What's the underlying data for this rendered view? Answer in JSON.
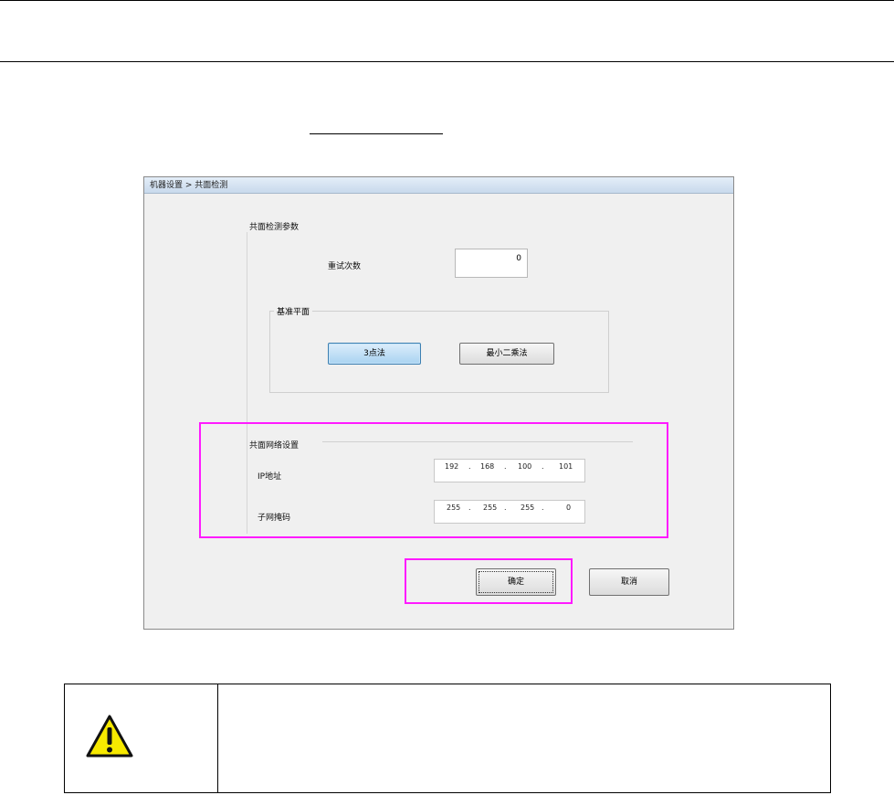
{
  "dialog": {
    "title": "机器设置 > 共面检测",
    "params_section": "共面检测参数",
    "retry_label": "重试次数",
    "retry_value": "0",
    "ref_plane_group": "基准平面",
    "btn_3point": "3点法",
    "btn_lsq": "最小二乘法",
    "network_section": "共面网络设置",
    "ip_label": "IP地址",
    "ip_octets": [
      "192",
      "168",
      "100",
      "101"
    ],
    "mask_label": "子网掩码",
    "mask_octets": [
      "255",
      "255",
      "255",
      "0"
    ],
    "btn_ok": "确定",
    "btn_cancel": "取消"
  },
  "colors": {
    "highlight": "#ff1aff",
    "warning_fill": "#f7e900"
  },
  "icons": [
    "warning-icon"
  ]
}
